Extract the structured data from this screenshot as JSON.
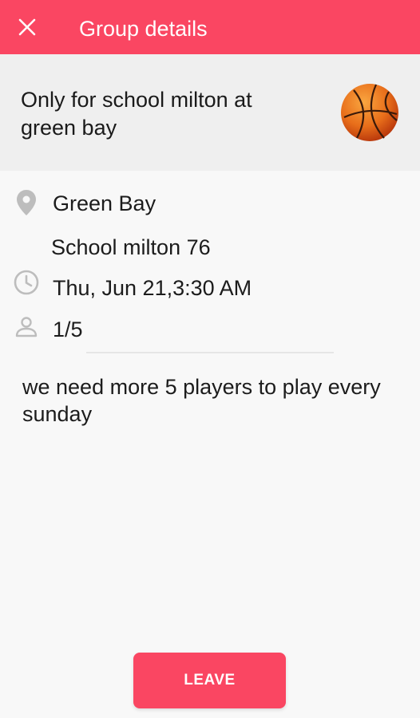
{
  "app_bar": {
    "title": "Group details",
    "close_icon": "close-icon",
    "color": "#fa4662"
  },
  "group": {
    "name": "Only for school milton at green bay",
    "sport_icon": "basketball-icon"
  },
  "details": {
    "city": "Green Bay",
    "address": "School milton 76",
    "datetime": "Thu, Jun 21,3:30 AM",
    "players": "1/5"
  },
  "description": "we need more 5 players to play every sunday",
  "actions": {
    "leave_label": "LEAVE"
  }
}
